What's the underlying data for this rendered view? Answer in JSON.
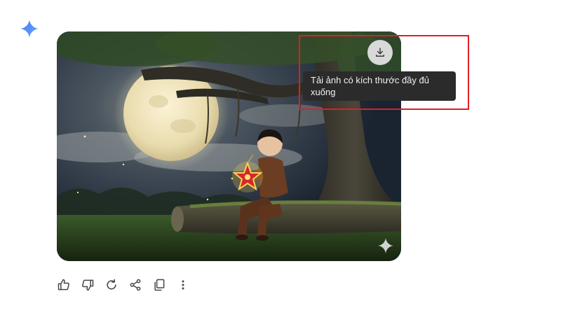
{
  "image": {
    "download_tooltip": "Tải ảnh có kích thước đầy đủ xuống"
  },
  "icons": {
    "logo": "gemini-spark-icon",
    "download": "download-icon",
    "watermark": "sparkle-icon",
    "actions": [
      "thumbs-up-icon",
      "thumbs-down-icon",
      "refresh-icon",
      "share-icon",
      "copy-icon",
      "more-vert-icon"
    ]
  },
  "colors": {
    "spark_blue": "#4a8cf7",
    "highlight_red": "#e01e24",
    "tooltip_bg": "#2b2b2b",
    "icon_gray": "#444746"
  }
}
